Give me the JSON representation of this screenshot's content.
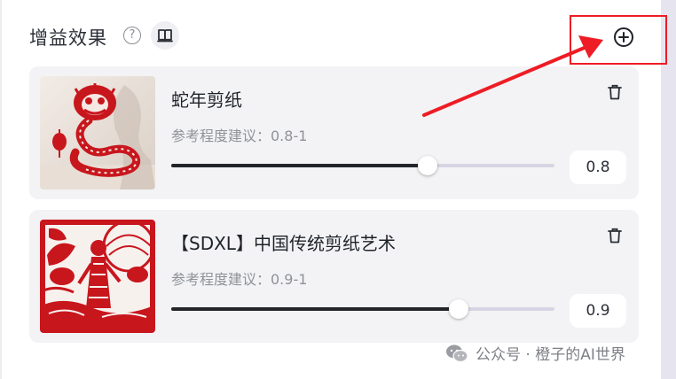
{
  "header": {
    "title": "增益效果",
    "help_symbol": "?",
    "book_icon": "book-icon",
    "add_icon": "plus-circle-icon"
  },
  "colors": {
    "highlight_red": "#ee1c25",
    "card_bg": "#f3f3f5",
    "slider_fill": "#222428",
    "slider_track": "#d7d5e3",
    "paper_cut_red": "#c8161d"
  },
  "effects": [
    {
      "title": "蛇年剪纸",
      "hint": "参考程度建议：0.8-1",
      "value": "0.8",
      "level": 0.8,
      "image_desc": "red paper-cut snake figure",
      "delete_icon": "trash-icon"
    },
    {
      "title": "【SDXL】中国传统剪纸艺术",
      "hint": "参考程度建议：0.9-1",
      "value": "0.9",
      "level": 0.9,
      "image_desc": "red paper-cut girl under trees",
      "delete_icon": "trash-icon"
    }
  ],
  "watermark": {
    "text": "公众号 · 橙子的AI世界",
    "icon": "wechat-icon"
  }
}
